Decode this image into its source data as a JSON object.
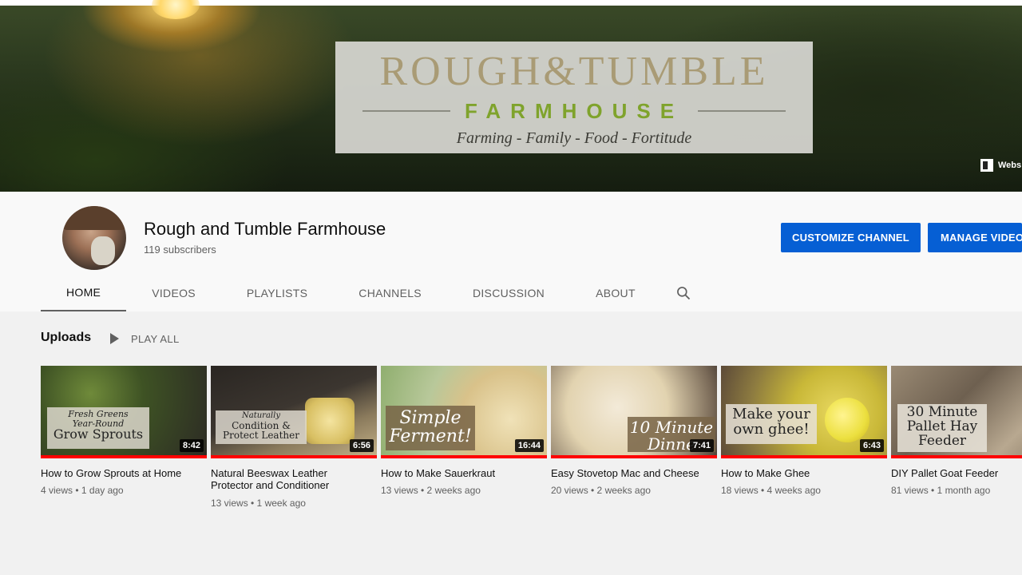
{
  "banner": {
    "logo_title": "ROUGH&TUMBLE",
    "logo_subtitle": "FARMHOUSE",
    "logo_tagline": "Farming - Family - Food - Fortitude",
    "website_badge": "Webs"
  },
  "channel": {
    "name": "Rough and Tumble Farmhouse",
    "subscribers": "119 subscribers",
    "customize_label": "CUSTOMIZE CHANNEL",
    "manage_label": "MANAGE VIDEOS"
  },
  "tabs": [
    {
      "label": "HOME",
      "active": true
    },
    {
      "label": "VIDEOS"
    },
    {
      "label": "PLAYLISTS"
    },
    {
      "label": "CHANNELS"
    },
    {
      "label": "DISCUSSION"
    },
    {
      "label": "ABOUT"
    }
  ],
  "shelf": {
    "title": "Uploads",
    "play_all": "PLAY ALL"
  },
  "videos": [
    {
      "title": "How to Grow Sprouts at Home",
      "duration": "8:42",
      "meta": "4 views • 1 day ago",
      "overlay": [
        "Fresh Greens",
        "Year-Round",
        "Grow Sprouts"
      ]
    },
    {
      "title": "Natural Beeswax Leather Protector and Conditioner",
      "duration": "6:56",
      "meta": "13 views • 1 week ago",
      "overlay": [
        "Naturally",
        "Condition &",
        "Protect Leather"
      ]
    },
    {
      "title": "How to Make Sauerkraut",
      "duration": "16:44",
      "meta": "13 views • 2 weeks ago",
      "overlay": [
        "Simple",
        "Ferment!"
      ]
    },
    {
      "title": "Easy Stovetop Mac and Cheese",
      "duration": "7:41",
      "meta": "20 views • 2 weeks ago",
      "overlay": [
        "10 Minute",
        "Dinne"
      ]
    },
    {
      "title": "How to Make Ghee",
      "duration": "6:43",
      "meta": "18 views • 4 weeks ago",
      "overlay": [
        "Make your",
        "own ghee!"
      ]
    },
    {
      "title": "DIY Pallet Goat Feeder",
      "duration": "",
      "meta": "81 views • 1 month ago",
      "overlay": [
        "30 Minute",
        "Pallet Hay",
        "Feeder"
      ]
    }
  ]
}
